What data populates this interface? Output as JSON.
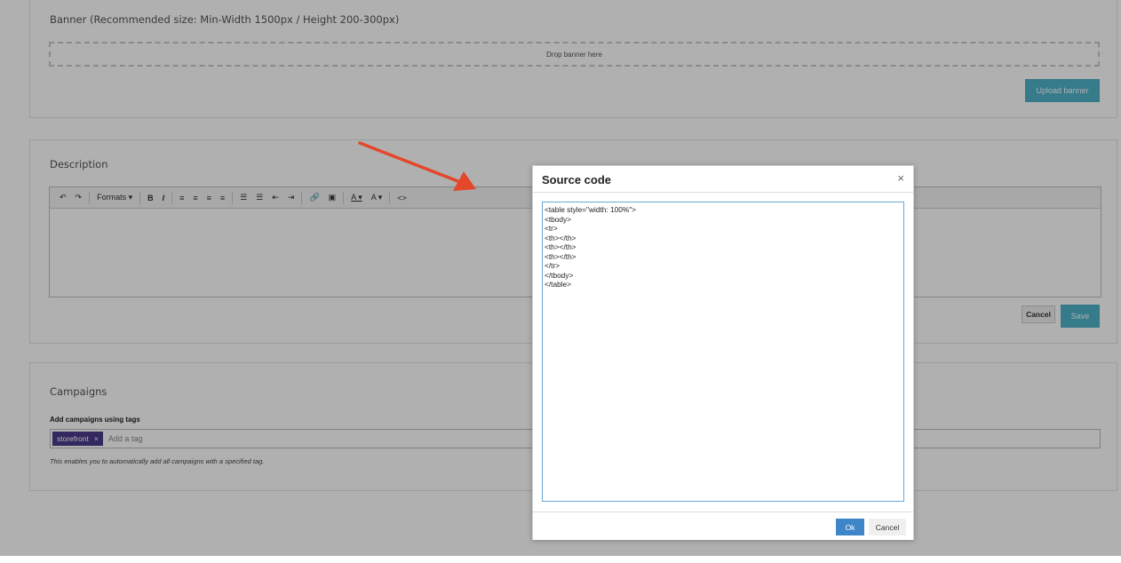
{
  "banner": {
    "title": "Banner (Recommended size: Min-Width 1500px / Height 200-300px)",
    "dropzone_text": "Drop banner here",
    "upload_label": "Upload banner"
  },
  "description": {
    "title": "Description",
    "toolbar": {
      "undo": "↶",
      "redo": "↷",
      "formats": "Formats ▾",
      "bold": "B",
      "italic": "I",
      "align_left": "≡",
      "align_center": "≡",
      "align_right": "≡",
      "align_justify": "≡",
      "bullet_list": "☰",
      "numbered_list": "☰",
      "outdent": "⇤",
      "indent": "⇥",
      "link": "🔗",
      "image": "▣",
      "text_color": "A ▾",
      "bg_color": "A ▾",
      "source_code": "<>"
    },
    "cancel_label": "Cancel",
    "save_label": "Save"
  },
  "campaigns": {
    "title": "Campaigns",
    "tags_label": "Add campaigns using tags",
    "tag": "storefront",
    "tag_remove": "×",
    "placeholder": "Add a tag",
    "help": "This enables you to automatically add all campaigns with a specified tag."
  },
  "modal": {
    "title": "Source code",
    "close": "×",
    "source": "<table style=\"width: 100%\">\n<tbody>\n<tr>\n<th></th>\n<th></th>\n<th></th>\n</tr>\n</tbody>\n</table>",
    "ok_label": "Ok",
    "cancel_label": "Cancel"
  },
  "colors": {
    "accent": "#4fb3c9",
    "tag": "#4a3a8c",
    "primary": "#3f86c8",
    "arrow": "#e4472a"
  }
}
